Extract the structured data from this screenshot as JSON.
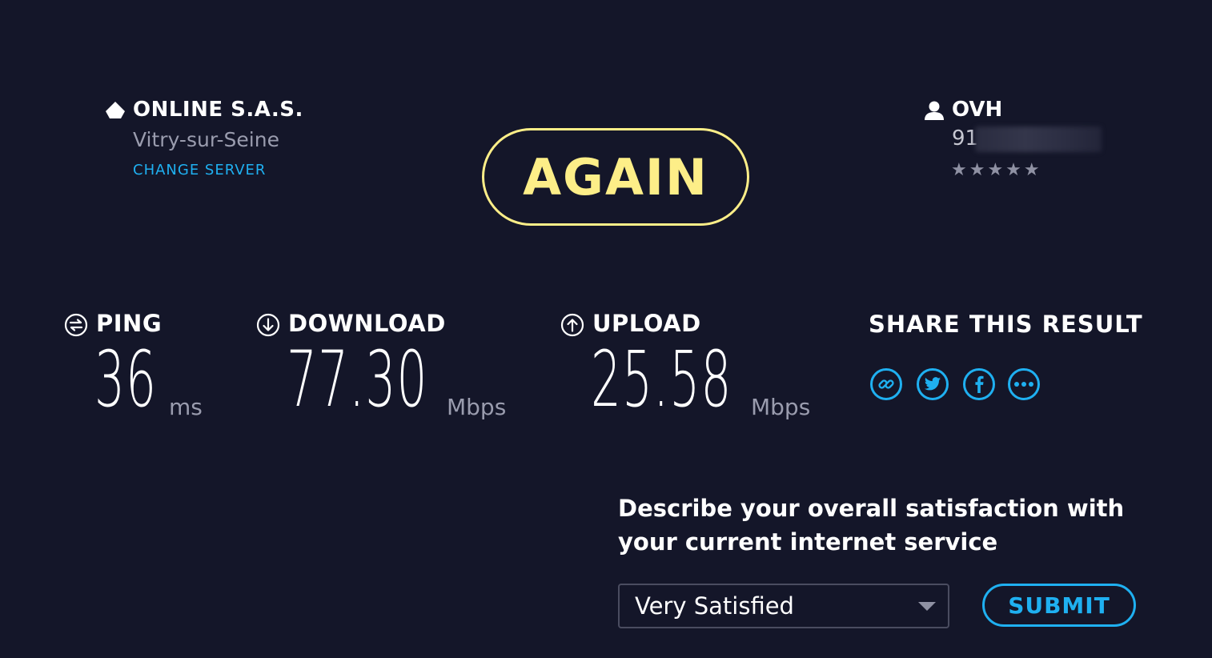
{
  "server": {
    "name": "ONLINE S.A.S.",
    "city": "Vitry-sur-Seine",
    "change_label": "CHANGE SERVER"
  },
  "again_label": "AGAIN",
  "isp": {
    "name": "OVH",
    "ip_prefix": "91.",
    "rating": "★★★★★"
  },
  "metrics": {
    "ping": {
      "label": "PING",
      "value": "36",
      "unit": "ms"
    },
    "download": {
      "label": "DOWNLOAD",
      "value": "77.30",
      "unit": "Mbps"
    },
    "upload": {
      "label": "UPLOAD",
      "value": "25.58",
      "unit": "Mbps"
    }
  },
  "share": {
    "title": "SHARE THIS RESULT",
    "buttons": [
      "link-icon",
      "twitter-icon",
      "facebook-icon",
      "more-icon"
    ]
  },
  "survey": {
    "question": "Describe your overall satisfaction with your current internet service",
    "selected": "Very Satisfied",
    "submit_label": "SUBMIT"
  },
  "colors": {
    "background": "#141629",
    "accent_yellow": "#fdee88",
    "accent_blue": "#1fb0f1",
    "muted_text": "#9a9cae"
  }
}
